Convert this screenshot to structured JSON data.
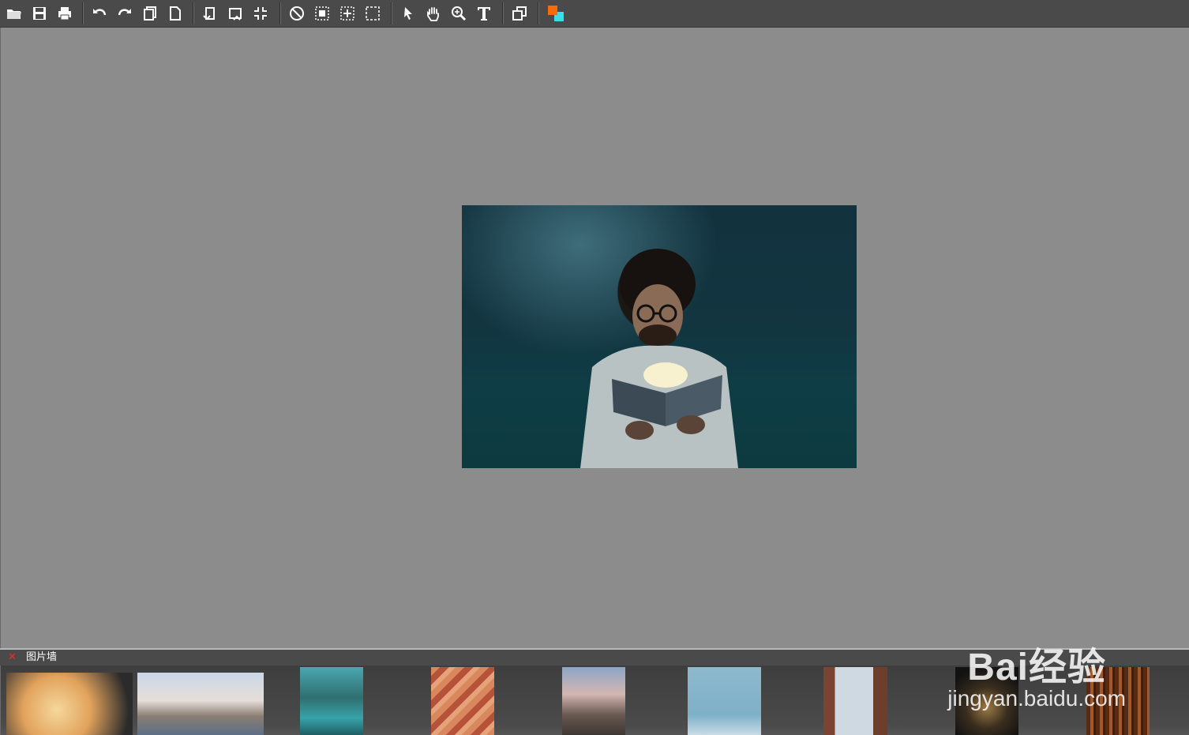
{
  "toolbar": {
    "groups": [
      [
        "open-folder-icon",
        "save-icon",
        "print-icon"
      ],
      [
        "undo-icon",
        "redo-icon",
        "copy-icon",
        "new-page-icon"
      ],
      [
        "rotate-left-icon",
        "rotate-right-icon",
        "fit-screen-icon"
      ],
      [
        "no-symbol-icon",
        "select-rect-icon",
        "select-center-icon",
        "dashed-select-icon"
      ],
      [
        "pointer-icon",
        "hand-icon",
        "zoom-icon",
        "text-icon"
      ],
      [
        "duplicate-icon"
      ],
      [
        "color-swatch-icon"
      ]
    ],
    "colors": {
      "foreground": "#ff6a00",
      "background": "#33e0f0"
    }
  },
  "picture_wall": {
    "title": "图片墙",
    "close_label": "✕"
  },
  "watermark": {
    "brand": "Bai经验",
    "url": "jingyan.baidu.com"
  }
}
